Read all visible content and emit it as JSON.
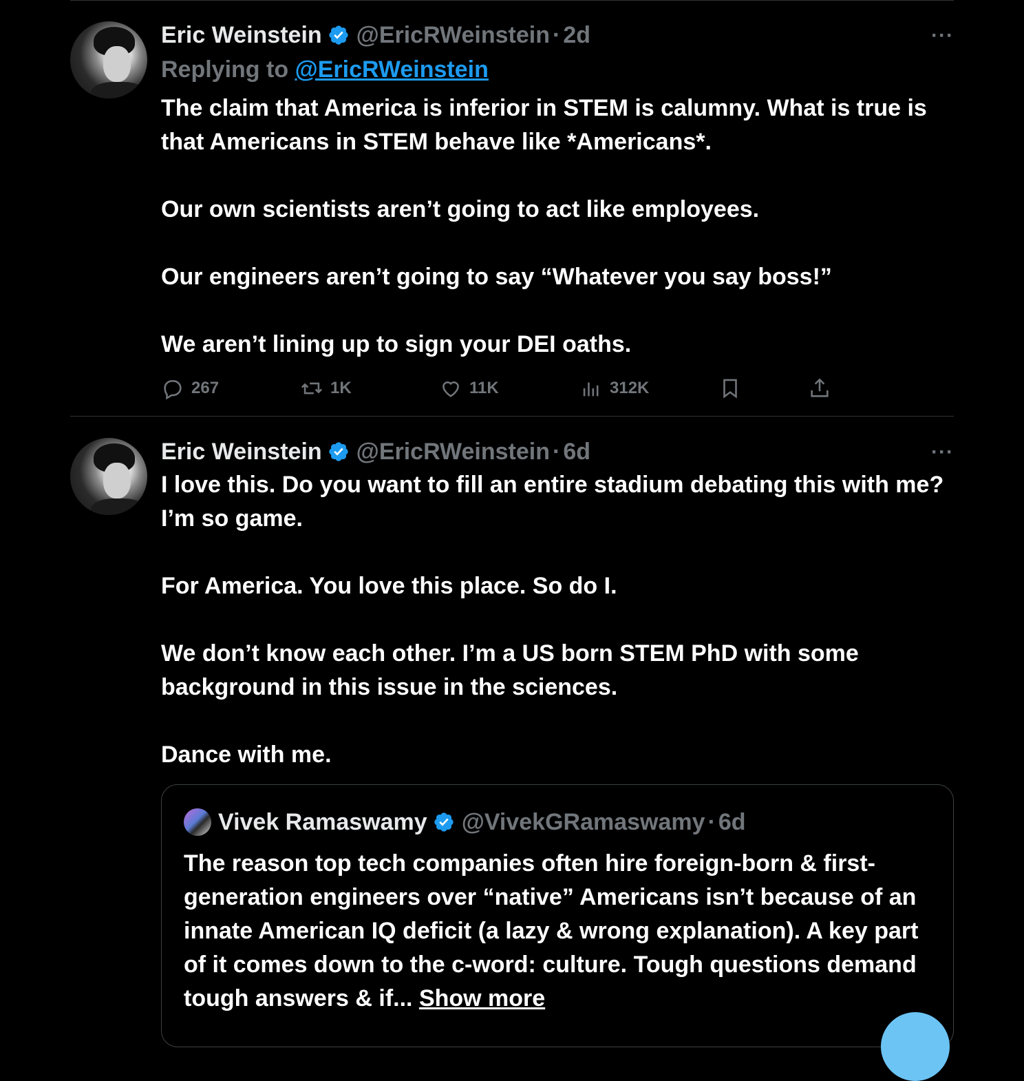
{
  "tweets": [
    {
      "author": {
        "name": "Eric Weinstein",
        "handle": "@EricRWeinstein",
        "time": "2d"
      },
      "replying_label": "Replying to",
      "replying_to": "@EricRWeinstein",
      "paragraphs": [
        "The claim that America is inferior in STEM is calumny. What is true is that Americans in STEM behave like *Americans*.",
        "Our own scientists aren’t going to act like employees.",
        "Our engineers aren’t going to say “Whatever you say boss!”",
        "We aren’t lining up to sign your DEI oaths."
      ],
      "stats": {
        "replies": "267",
        "reposts": "1K",
        "likes": "11K",
        "views": "312K"
      }
    },
    {
      "author": {
        "name": "Eric Weinstein",
        "handle": "@EricRWeinstein",
        "time": "6d"
      },
      "paragraphs": [
        "I love this. Do you want to fill an entire stadium debating this with me? I’m so game.",
        "For America. You love this place. So do I.",
        "We don’t know each other. I’m a US born STEM PhD with some background in this issue in the sciences.",
        "Dance with me."
      ],
      "quote": {
        "author": {
          "name": "Vivek Ramaswamy",
          "handle": "@VivekGRamaswamy",
          "time": "6d"
        },
        "text": "The reason top tech companies often hire foreign-born & first-generation engineers over “native” Americans isn’t because of an innate American IQ deficit (a lazy & wrong explanation). A key part of it comes down to the c-word: culture. Tough questions demand tough answers & if...",
        "show_more": "Show more"
      }
    }
  ],
  "ui": {
    "dot": "·",
    "more": "···",
    "colors": {
      "accent": "#1d9bf0",
      "muted": "#71767b",
      "border": "#2f3336"
    },
    "icons": [
      "verified-badge-icon",
      "reply-icon",
      "repost-icon",
      "like-icon",
      "views-icon",
      "bookmark-icon",
      "share-icon",
      "more-icon"
    ]
  }
}
